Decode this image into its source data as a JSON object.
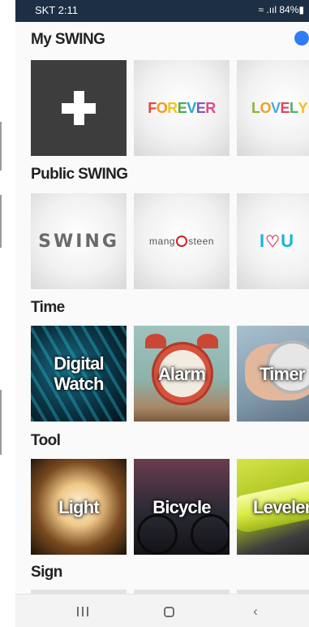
{
  "status_bar": {
    "carrier_time": "SKT 2:11",
    "indicators": "≈ .ııl 84%▮"
  },
  "sections": {
    "my_swing": "My SWING",
    "public_swing": "Public SWING",
    "time": "Time",
    "tool": "Tool",
    "sign": "Sign"
  },
  "my_swing_tiles": {
    "forever_letters": [
      "F",
      "O",
      "R",
      "E",
      "V",
      "E",
      "R"
    ],
    "forever_colors": [
      "#e34a3a",
      "#f09a1d",
      "#f3c41e",
      "#4cae4c",
      "#2f9fd8",
      "#7a5bc4",
      "#e04888"
    ],
    "lovely_letters": [
      "L",
      "O",
      "V",
      "E",
      "L",
      "Y"
    ],
    "lovely_colors": [
      "#8fb23a",
      "#f0a020",
      "#4aa8d8",
      "#e0455a",
      "#49b36b",
      "#f1c21b"
    ]
  },
  "public_swing_tiles": {
    "swing": "SWING",
    "mango_left": "mang",
    "mango_right": "steen",
    "ilove_i": "I",
    "ilove_heart": "♡",
    "ilove_u": "U"
  },
  "time_tiles": {
    "digital_watch_line1": "Digital",
    "digital_watch_line2": "Watch",
    "alarm": "Alarm",
    "timer": "Timer"
  },
  "tool_tiles": {
    "light": "Light",
    "bicycle": "Bicycle",
    "leveler": "Leveler"
  },
  "navbar": {
    "recent": "recent-apps-icon",
    "home": "home-icon",
    "back": "‹"
  },
  "colors": {
    "status_bar": "#1d2f44",
    "accent_dot": "#2f7cf6",
    "plus_tile": "#3d3d3d"
  }
}
